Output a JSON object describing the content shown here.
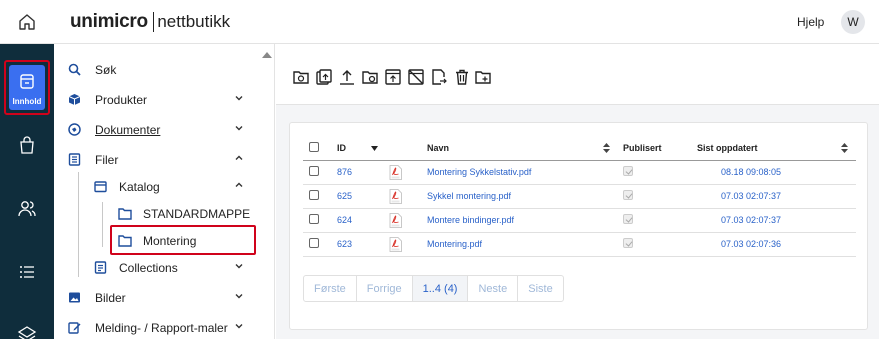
{
  "header": {
    "brand": "unimicro",
    "product": "nettbutikk",
    "help_label": "Hjelp",
    "avatar_initial": "W"
  },
  "rail": {
    "active_label": "Innhold",
    "items": [
      "store-icon",
      "shopping-bag-icon",
      "users-icon",
      "list-icon",
      "layers-icon"
    ]
  },
  "nav": {
    "items": [
      {
        "label": "Søk",
        "icon": "search-icon"
      },
      {
        "label": "Produkter",
        "icon": "cube-icon",
        "chevron": "down"
      },
      {
        "label": "Dokumenter",
        "icon": "globe-icon",
        "chevron": "down"
      },
      {
        "label": "Filer",
        "icon": "file-list-icon",
        "chevron": "up"
      },
      {
        "label": "Katalog",
        "icon": "catalog-icon",
        "chevron": "up"
      },
      {
        "label": "STANDARDMAPPE",
        "icon": "folder-icon"
      },
      {
        "label": "Montering",
        "icon": "folder-icon",
        "selected": true
      },
      {
        "label": "Collections",
        "icon": "collections-icon",
        "chevron": "down"
      },
      {
        "label": "Bilder",
        "icon": "image-icon",
        "chevron": "down"
      },
      {
        "label": "Melding- / Rapport-maler",
        "icon": "edit-icon",
        "chevron": "down"
      }
    ]
  },
  "toolbar": {
    "icons": [
      "new-folder-icon",
      "copy-icon",
      "upload-icon",
      "folder-settings-icon",
      "upload-to-folder-icon",
      "unpublish-icon",
      "move-icon",
      "delete-icon",
      "add-folder-icon"
    ]
  },
  "table": {
    "columns": {
      "id": "ID",
      "name": "Navn",
      "published": "Publisert",
      "updated": "Sist oppdatert"
    },
    "rows": [
      {
        "id": "876",
        "name": "Montering Sykkelstativ.pdf",
        "updated": "08.18 09:08:05"
      },
      {
        "id": "625",
        "name": "Sykkel montering.pdf",
        "updated": "07.03 02:07:37"
      },
      {
        "id": "624",
        "name": "Montere bindinger.pdf",
        "updated": "07.03 02:07:37"
      },
      {
        "id": "623",
        "name": "Montering.pdf",
        "updated": "07.03 02:07:36"
      }
    ]
  },
  "pager": {
    "first": "Første",
    "prev": "Forrige",
    "current": "1..4 (4)",
    "next": "Neste",
    "last": "Siste"
  },
  "colors": {
    "rail_bg": "#0f2d3c",
    "accent": "#3a6ff0",
    "highlight": "#d0021b",
    "link": "#2a62c9"
  }
}
